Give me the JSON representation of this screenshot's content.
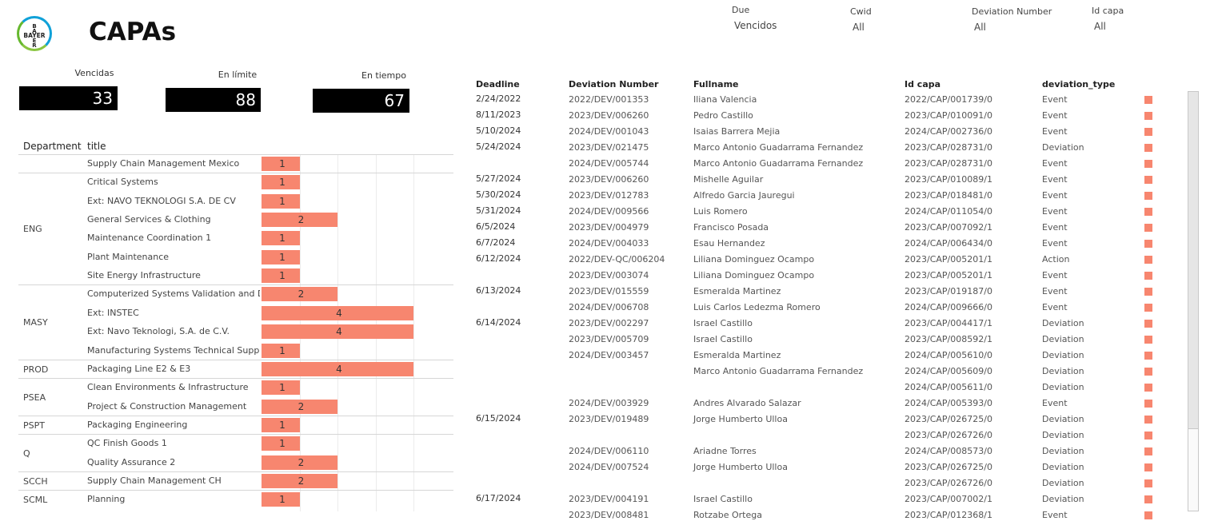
{
  "header": {
    "logo_text": "BAYER",
    "title": "CAPAs"
  },
  "filters": [
    {
      "label": "Due",
      "value": "Vencidos"
    },
    {
      "label": "Cwid",
      "value": "All"
    },
    {
      "label": "Deviation Number",
      "value": "All"
    },
    {
      "label": "Id capa",
      "value": "All"
    }
  ],
  "kpis": [
    {
      "label": "Vencidas",
      "value": "33"
    },
    {
      "label": "En límite",
      "value": "88"
    },
    {
      "label": "En tiempo",
      "value": "67"
    }
  ],
  "colors": {
    "bar": "#f7866f",
    "kpi_bg": "#000000"
  },
  "left_table": {
    "headers": {
      "department": "Department",
      "title": "title"
    },
    "groups": [
      {
        "department": "",
        "rows": [
          {
            "title": "Supply Chain Management Mexico",
            "count": 1
          }
        ]
      },
      {
        "department": "ENG",
        "rows": [
          {
            "title": "Critical Systems",
            "count": 1
          },
          {
            "title": "Ext: NAVO TEKNOLOGI S.A. DE CV",
            "count": 1
          },
          {
            "title": "General Services & Clothing",
            "count": 2
          },
          {
            "title": "Maintenance Coordination 1",
            "count": 1
          },
          {
            "title": "Plant Maintenance",
            "count": 1
          },
          {
            "title": "Site Energy Infrastructure",
            "count": 1
          }
        ]
      },
      {
        "department": "MASY",
        "rows": [
          {
            "title": "Computerized Systems Validation and DI",
            "count": 2
          },
          {
            "title": "Ext: INSTEC",
            "count": 4
          },
          {
            "title": "Ext: Navo Teknologi, S.A. de C.V.",
            "count": 4
          },
          {
            "title": "Manufacturing Systems Technical Suppo..",
            "count": 1
          }
        ]
      },
      {
        "department": "PROD",
        "rows": [
          {
            "title": "Packaging Line E2 & E3",
            "count": 4
          }
        ]
      },
      {
        "department": "PSEA",
        "rows": [
          {
            "title": "Clean Environments & Infrastructure",
            "count": 1
          },
          {
            "title": "Project & Construction Management",
            "count": 2
          }
        ]
      },
      {
        "department": "PSPT",
        "rows": [
          {
            "title": "Packaging Engineering",
            "count": 1
          }
        ]
      },
      {
        "department": "Q",
        "rows": [
          {
            "title": "QC Finish Goods 1",
            "count": 1
          },
          {
            "title": "Quality Assurance 2",
            "count": 2
          }
        ]
      },
      {
        "department": "SCCH",
        "rows": [
          {
            "title": "Supply Chain Management CH",
            "count": 2
          }
        ]
      },
      {
        "department": "SCML",
        "rows": [
          {
            "title": "Planning",
            "count": 1
          }
        ]
      }
    ]
  },
  "right_table": {
    "headers": [
      "Deadline",
      "Deviation Number",
      "Fullname",
      "Id capa",
      "deviation_type"
    ],
    "rows": [
      [
        "2/24/2022",
        "2022/DEV/001353",
        "Iliana Valencia",
        "2022/CAP/001739/0",
        "Event"
      ],
      [
        "8/11/2023",
        "2023/DEV/006260",
        "Pedro Castillo",
        "2023/CAP/010091/0",
        "Event"
      ],
      [
        "5/10/2024",
        "2024/DEV/001043",
        "Isaias Barrera Mejia",
        "2024/CAP/002736/0",
        "Event"
      ],
      [
        "5/24/2024",
        "2023/DEV/021475",
        "Marco Antonio Guadarrama Fernandez",
        "2023/CAP/028731/0",
        "Deviation"
      ],
      [
        "",
        "2024/DEV/005744",
        "Marco Antonio Guadarrama Fernandez",
        "2023/CAP/028731/0",
        "Event"
      ],
      [
        "5/27/2024",
        "2023/DEV/006260",
        "Mishelle Aguilar",
        "2023/CAP/010089/1",
        "Event"
      ],
      [
        "5/30/2024",
        "2023/DEV/012783",
        "Alfredo Garcia Jauregui",
        "2023/CAP/018481/0",
        "Event"
      ],
      [
        "5/31/2024",
        "2024/DEV/009566",
        "Luis Romero",
        "2024/CAP/011054/0",
        "Event"
      ],
      [
        "6/5/2024",
        "2023/DEV/004979",
        "Francisco Posada",
        "2023/CAP/007092/1",
        "Event"
      ],
      [
        "6/7/2024",
        "2024/DEV/004033",
        "Esau Hernandez",
        "2024/CAP/006434/0",
        "Event"
      ],
      [
        "6/12/2024",
        "2022/DEV-QC/006204",
        "Liliana Dominguez Ocampo",
        "2023/CAP/005201/1",
        "Action"
      ],
      [
        "",
        "2023/DEV/003074",
        "Liliana Dominguez Ocampo",
        "2023/CAP/005201/1",
        "Event"
      ],
      [
        "6/13/2024",
        "2023/DEV/015559",
        "Esmeralda Martinez",
        "2023/CAP/019187/0",
        "Event"
      ],
      [
        "",
        "2024/DEV/006708",
        "Luis Carlos Ledezma Romero",
        "2024/CAP/009666/0",
        "Event"
      ],
      [
        "6/14/2024",
        "2023/DEV/002297",
        "Israel Castillo",
        "2023/CAP/004417/1",
        "Deviation"
      ],
      [
        "",
        "2023/DEV/005709",
        "Israel Castillo",
        "2023/CAP/008592/1",
        "Deviation"
      ],
      [
        "",
        "2024/DEV/003457",
        "Esmeralda Martinez",
        "2024/CAP/005610/0",
        "Deviation"
      ],
      [
        "",
        "",
        "Marco Antonio Guadarrama Fernandez",
        "2024/CAP/005609/0",
        "Deviation"
      ],
      [
        "",
        "",
        "",
        "2024/CAP/005611/0",
        "Deviation"
      ],
      [
        "",
        "2024/DEV/003929",
        "Andres Alvarado Salazar",
        "2024/CAP/005393/0",
        "Event"
      ],
      [
        "6/15/2024",
        "2023/DEV/019489",
        "Jorge Humberto Ulloa",
        "2023/CAP/026725/0",
        "Deviation"
      ],
      [
        "",
        "",
        "",
        "2023/CAP/026726/0",
        "Deviation"
      ],
      [
        "",
        "2024/DEV/006110",
        "Ariadne Torres",
        "2024/CAP/008573/0",
        "Deviation"
      ],
      [
        "",
        "2024/DEV/007524",
        "Jorge Humberto Ulloa",
        "2023/CAP/026725/0",
        "Deviation"
      ],
      [
        "",
        "",
        "",
        "2023/CAP/026726/0",
        "Deviation"
      ],
      [
        "6/17/2024",
        "2023/DEV/004191",
        "Israel Castillo",
        "2023/CAP/007002/1",
        "Deviation"
      ],
      [
        "",
        "2023/DEV/008481",
        "Rotzabe Ortega",
        "2023/CAP/012368/1",
        "Event"
      ]
    ]
  }
}
